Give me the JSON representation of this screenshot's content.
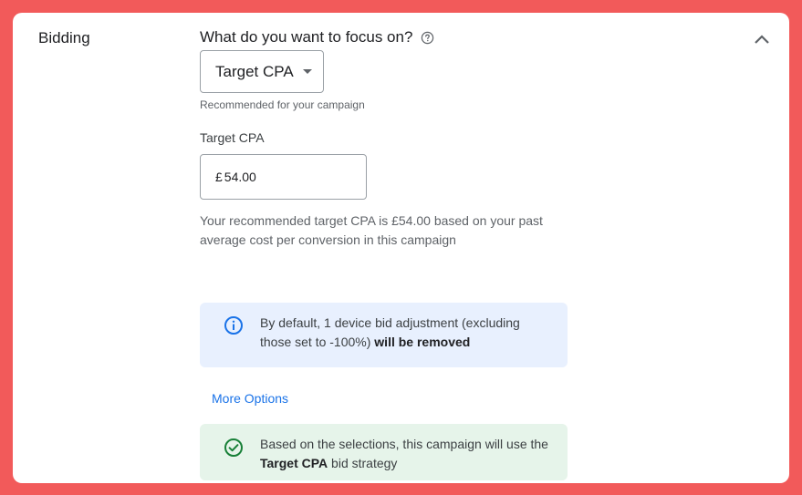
{
  "section": {
    "label": "Bidding"
  },
  "focus": {
    "question": "What do you want to focus on?",
    "selected_option": "Target CPA",
    "hint": "Recommended for your campaign"
  },
  "target_cpa": {
    "label": "Target CPA",
    "currency_symbol": "£",
    "value": "54.00",
    "recommendation": "Your recommended target CPA is £54.00 based on your past average cost per conversion in this campaign"
  },
  "info_banner": {
    "text": "By default, 1 device bid adjustment (excluding those set to -100%) ",
    "bold_text": "will be removed",
    "icon": "info-icon"
  },
  "more_options": {
    "label": "More Options"
  },
  "success_banner": {
    "text_before": "Based on the selections, this campaign will use the ",
    "bold_text": "Target CPA",
    "text_after": " bid strategy",
    "icon": "check-circle-icon"
  },
  "colors": {
    "frame": "#f25a5a",
    "link": "#1a73e8",
    "info_bg": "#e8f0fe",
    "info_icon": "#1a73e8",
    "success_bg": "#e6f4ea",
    "success_icon": "#188038"
  }
}
